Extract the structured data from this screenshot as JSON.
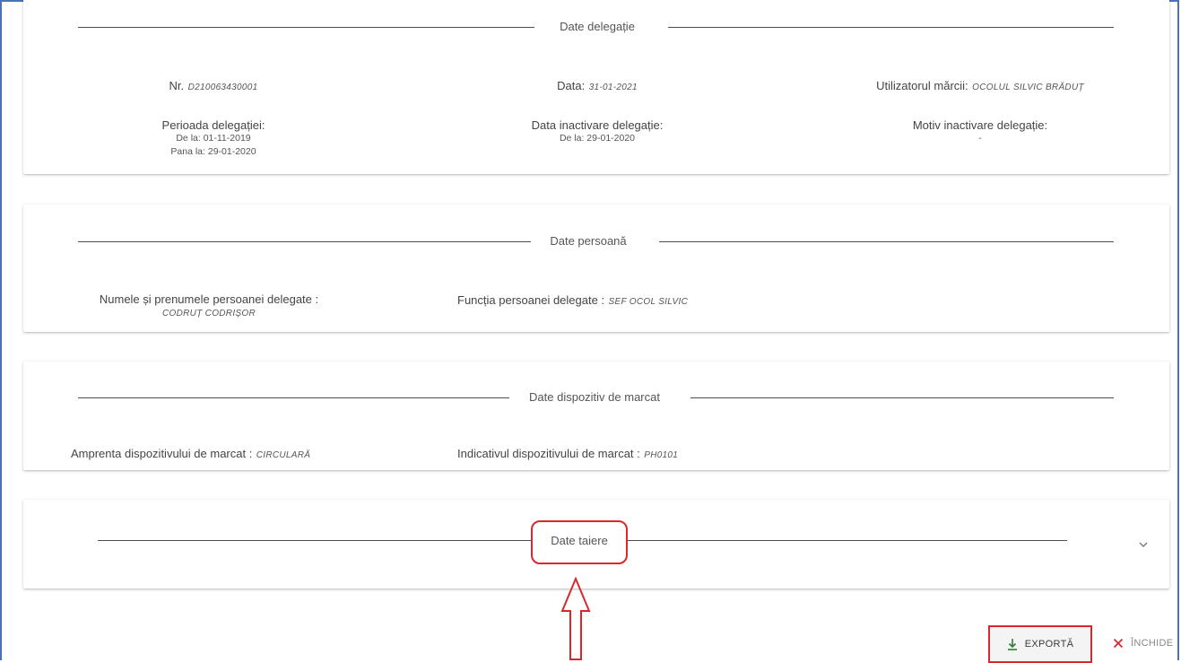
{
  "delegation": {
    "section_title": "Date delegație",
    "nr_label": "Nr.",
    "nr_value": "D210063430001",
    "date_label": "Data:",
    "date_value": "31-01-2021",
    "user_label": "Utilizatorul mărcii:",
    "user_value": "OCOLUL SILVIC BRĂDUȚ",
    "period_label": "Perioada delegației:",
    "period_from": "De la: 01-11-2019",
    "period_to": "Pana la: 29-01-2020",
    "inactive_label": "Data inactivare delegație:",
    "inactive_from": "De la: 29-01-2020",
    "reason_label": "Motiv inactivare delegație:",
    "reason_value": "-"
  },
  "person": {
    "section_title": "Date persoană",
    "name_label": "Numele și prenumele persoanei delegate :",
    "name_value": "CODRUȚ CODRIȘOR",
    "function_label": "Funcția persoanei delegate :",
    "function_value": "SEF OCOL SILVIC"
  },
  "device": {
    "section_title": "Date dispozitiv de marcat",
    "imprint_label": "Amprenta dispozitivului de marcat :",
    "imprint_value": "CIRCULARĂ",
    "indicator_label": "Indicativul dispozitivului de marcat :",
    "indicator_value": "PH0101"
  },
  "cutting": {
    "section_title": "Date taiere",
    "chevron_icon": "chevron-down-icon"
  },
  "actions": {
    "export_label": "EXPORTĂ",
    "export_icon": "download-icon",
    "close_label": "ÎNCHIDE",
    "close_icon": "close-icon",
    "export_color": "#2e7d32",
    "close_color": "#d9272e"
  },
  "annotations": {
    "highlight_color": "#d9272e"
  }
}
